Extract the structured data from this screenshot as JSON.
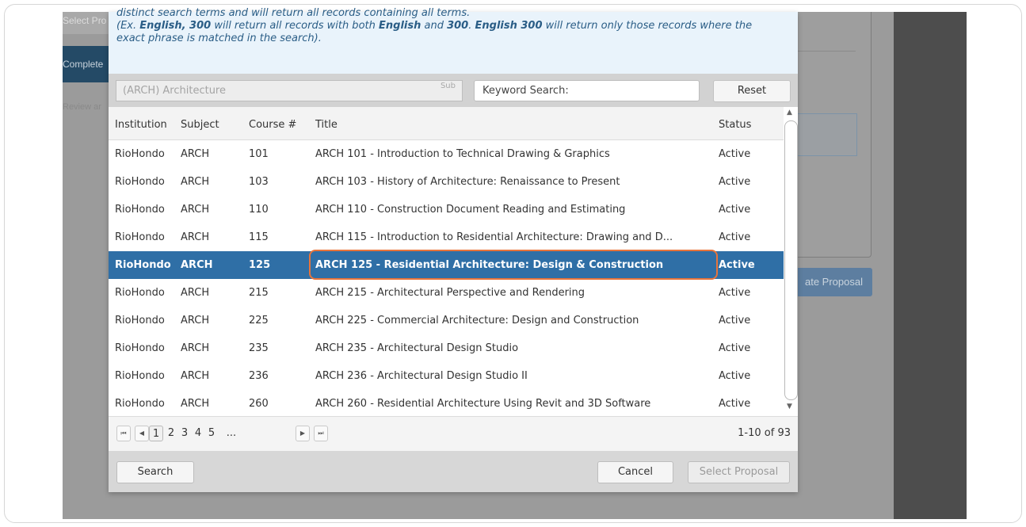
{
  "background": {
    "sidebar": {
      "select_step": "Select Pro",
      "complete_step": "Complete",
      "review_step": "Review ar"
    },
    "create_button": "ate Proposal"
  },
  "modal": {
    "info": {
      "line1": "distinct search terms and will return all records containing all terms.",
      "line2_pre": "(Ex. ",
      "line2_b1": "English, 300",
      "line2_mid1": " will return all records with both ",
      "line2_b2": "English",
      "line2_mid2": " and ",
      "line2_b3": "300",
      "line2_mid3": ". ",
      "line2_b4": "English 300",
      "line2_end": " will return only those records where the",
      "line3": "exact phrase is matched in the search)."
    },
    "filter": {
      "subject_value": "(ARCH) Architecture",
      "subject_tag": "Sub",
      "keyword_placeholder": "Keyword Search:",
      "reset_label": "Reset"
    },
    "grid": {
      "columns": [
        "Institution",
        "Subject",
        "Course #",
        "Title",
        "Status"
      ],
      "rows": [
        {
          "institution": "RioHondo",
          "subject": "ARCH",
          "number": "101",
          "title": "ARCH 101 - Introduction to Technical Drawing & Graphics",
          "status": "Active"
        },
        {
          "institution": "RioHondo",
          "subject": "ARCH",
          "number": "103",
          "title": "ARCH 103 - History of Architecture: Renaissance to Present",
          "status": "Active"
        },
        {
          "institution": "RioHondo",
          "subject": "ARCH",
          "number": "110",
          "title": "ARCH 110 - Construction Document Reading and Estimating",
          "status": "Active"
        },
        {
          "institution": "RioHondo",
          "subject": "ARCH",
          "number": "115",
          "title": "ARCH 115 - Introduction to Residential Architecture: Drawing and D...",
          "status": "Active"
        },
        {
          "institution": "RioHondo",
          "subject": "ARCH",
          "number": "125",
          "title": "ARCH 125 - Residential Architecture: Design & Construction",
          "status": "Active"
        },
        {
          "institution": "RioHondo",
          "subject": "ARCH",
          "number": "215",
          "title": "ARCH 215 - Architectural Perspective and Rendering",
          "status": "Active"
        },
        {
          "institution": "RioHondo",
          "subject": "ARCH",
          "number": "225",
          "title": "ARCH 225 - Commercial Architecture: Design and Construction",
          "status": "Active"
        },
        {
          "institution": "RioHondo",
          "subject": "ARCH",
          "number": "235",
          "title": "ARCH 235 - Architectural Design Studio",
          "status": "Active"
        },
        {
          "institution": "RioHondo",
          "subject": "ARCH",
          "number": "236",
          "title": "ARCH 236 - Architectural Design Studio II",
          "status": "Active"
        },
        {
          "institution": "RioHondo",
          "subject": "ARCH",
          "number": "260",
          "title": "ARCH 260 - Residential Architecture Using Revit and 3D Software",
          "status": "Active"
        }
      ],
      "selected_index": 4
    },
    "pager": {
      "pages": [
        "1",
        "2",
        "3",
        "4",
        "5",
        "..."
      ],
      "current": "1",
      "range": "1-10 of 93"
    },
    "footer": {
      "search_label": "Search",
      "cancel_label": "Cancel",
      "select_label": "Select Proposal"
    }
  }
}
